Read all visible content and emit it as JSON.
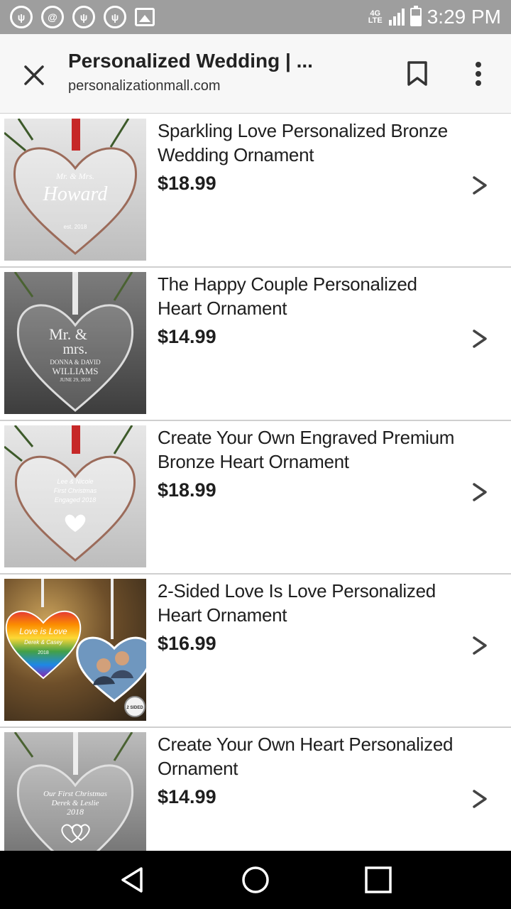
{
  "status_bar": {
    "network": "4G LTE",
    "time": "3:29 PM",
    "notification_icons": [
      "wifi-tower-icon",
      "at-sign-icon",
      "wifi-tower-icon",
      "wifi-tower-icon",
      "image-icon"
    ]
  },
  "toolbar": {
    "title": "Personalized Wedding | ...",
    "url": "personalizationmall.com"
  },
  "products": [
    {
      "name": "Sparkling Love Personalized Bronze Wedding Ornament",
      "price": "$18.99",
      "thumb_text": [
        "Mr. & Mrs.",
        "Howard",
        "est. 2018"
      ],
      "ribbon": "red"
    },
    {
      "name": "The Happy Couple Personalized Heart Ornament",
      "price": "$14.99",
      "thumb_text": [
        "Mr. &",
        "mrs.",
        "DONNA & DAVID",
        "WILLIAMS",
        "JUNE 29, 2018"
      ],
      "ribbon": "white"
    },
    {
      "name": "Create Your Own Engraved Premium Bronze Heart Ornament",
      "price": "$18.99",
      "thumb_text": [
        "Lee & Nicole",
        "First Christmas",
        "Engaged 2018"
      ],
      "ribbon": "red"
    },
    {
      "name": "2-Sided Love Is Love Personalized Heart Ornament",
      "price": "$16.99",
      "thumb_text": [
        "Love is Love",
        "Derek & Casey",
        "2018",
        "2 SIDED"
      ],
      "ribbon": "white"
    },
    {
      "name": "Create Your Own Heart Personalized Ornament",
      "price": "$14.99",
      "thumb_text": [
        "Our First Christmas",
        "Derek & Leslie",
        "2018"
      ],
      "ribbon": "white"
    }
  ],
  "colors": {
    "status_bar": "#9e9e9e",
    "toolbar": "#f7f7f7",
    "nav_bar": "#000000",
    "divider": "#cfcfcf",
    "ribbon_red": "#c62828"
  }
}
